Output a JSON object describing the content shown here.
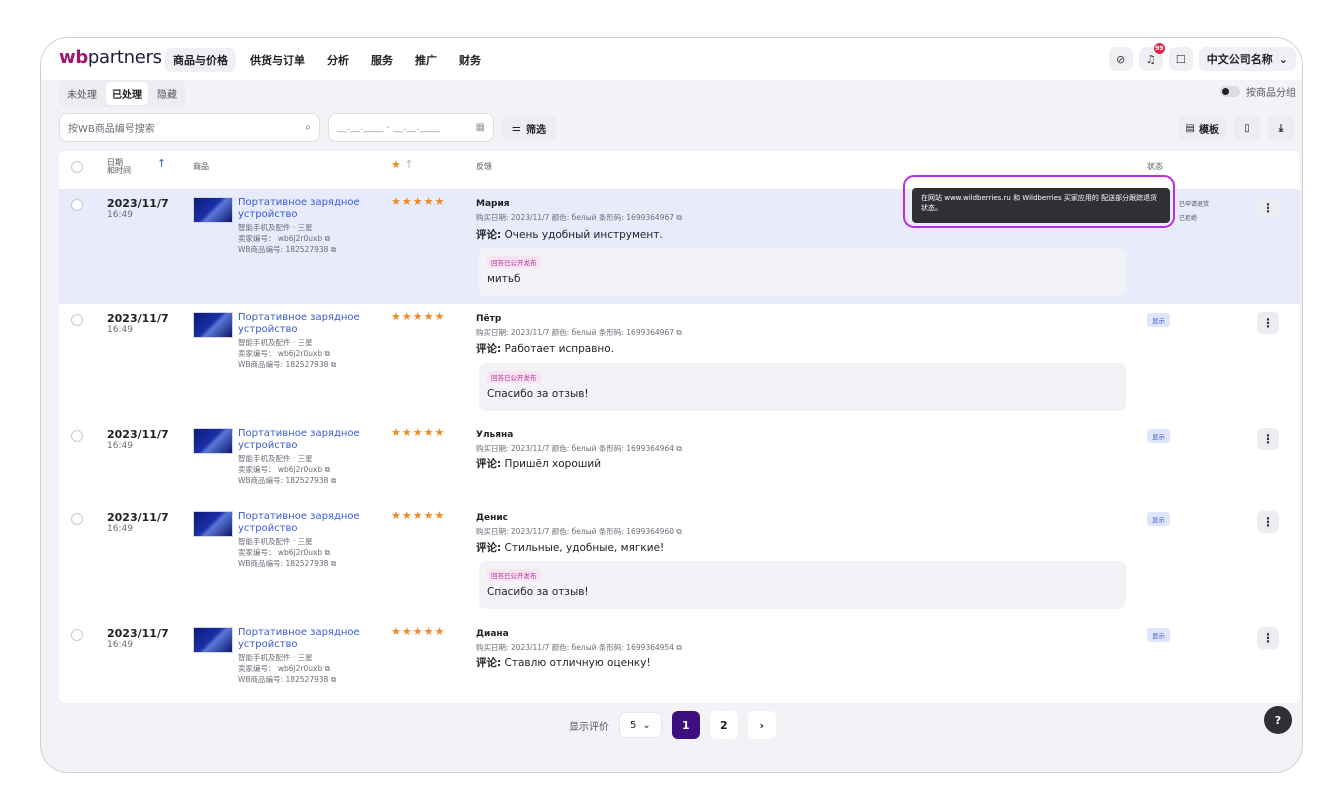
{
  "brand": {
    "logo_wb": "wb",
    "logo_rest": "partners"
  },
  "nav": [
    "商品与价格",
    "供货与订单",
    "分析",
    "服务",
    "推广",
    "财务"
  ],
  "top": {
    "notif_count": "99",
    "company": "中文公司名称"
  },
  "subtabs": [
    "未处理",
    "已处理",
    "隐藏"
  ],
  "group_toggle_label": "按商品分组",
  "search_placeholder": "按WB商品编号搜索",
  "date_placeholder": "__.__.____ - __.__.____",
  "filter_label": "筛选",
  "template_label": "模板",
  "headers": {
    "date": "日期",
    "datetime": "和时间",
    "product": "商品",
    "feedback": "反馈",
    "status": "状态"
  },
  "rows": [
    {
      "date": "2023/11/7",
      "time": "16:49",
      "product": "Портативное зарядное устройство",
      "category": "智能手机及配件 · 三星",
      "seller_sku": "卖家编号： wb6j2r0uxb",
      "wb_id": "WB商品编号: 182527938",
      "stars": "★★★★★",
      "user": "Мария",
      "meta": "购买日期: 2023/11/7   颜色: белый   条形码: 1699364967",
      "comment_prefix": "评论:",
      "comment": "Очень удобный инструмент.",
      "reply_tag": "回答已公开发布",
      "reply": "митьб",
      "status": ""
    },
    {
      "date": "2023/11/7",
      "time": "16:49",
      "product": "Портативное зарядное устройство",
      "category": "智能手机及配件 · 三星",
      "seller_sku": "卖家编号： wb6j2r0uxb",
      "wb_id": "WB商品编号: 182527938",
      "stars": "★★★★★",
      "user": "Пётр",
      "meta": "购买日期: 2023/11/7   颜色: белый   条形码: 1699364967",
      "comment_prefix": "评论:",
      "comment": "Работает исправно.",
      "reply_tag": "回答已公开发布",
      "reply": "Спасибо за отзыв!",
      "status": "显示"
    },
    {
      "date": "2023/11/7",
      "time": "16:49",
      "product": "Портативное зарядное устройство",
      "category": "智能手机及配件 · 三星",
      "seller_sku": "卖家编号： wb6j2r0uxb",
      "wb_id": "WB商品编号: 182527938",
      "stars": "★★★★★",
      "user": "Ульяна",
      "meta": "购买日期: 2023/11/7   颜色: белый   条形码: 1699364964",
      "comment_prefix": "评论:",
      "comment": "Пришёл хороший",
      "reply_tag": "",
      "reply": "",
      "status": "显示"
    },
    {
      "date": "2023/11/7",
      "time": "16:49",
      "product": "Портативное зарядное устройство",
      "category": "智能手机及配件 · 三星",
      "seller_sku": "卖家编号： wb6j2r0uxb",
      "wb_id": "WB商品编号: 182527938",
      "stars": "★★★★★",
      "user": "Денис",
      "meta": "购买日期: 2023/11/7   颜色: белый   条形码: 1699364960",
      "comment_prefix": "评论:",
      "comment": "Стильные, удобные, мягкие!",
      "reply_tag": "回答已公开发布",
      "reply": "Спасибо за отзыв!",
      "status": "显示"
    },
    {
      "date": "2023/11/7",
      "time": "16:49",
      "product": "Портативное зарядное устройство",
      "category": "智能手机及配件 · 三星",
      "seller_sku": "卖家编号： wb6j2r0uxb",
      "wb_id": "WB商品编号: 182527938",
      "stars": "★★★★★",
      "user": "Диана",
      "meta": "购买日期: 2023/11/7   颜色: белый   条形码: 1699364954",
      "comment_prefix": "评论:",
      "comment": "Ставлю отличную оценку!",
      "reply_tag": "",
      "reply": "",
      "status": "显示"
    }
  ],
  "tooltip": "在网站 www.wildberries.ru 和 Wildberries 买家应用的 配送部分跟踪退货状态。",
  "pending_status": [
    "已申请退货",
    "已拒绝"
  ],
  "pager": {
    "label": "显示评价",
    "page_size": "5",
    "pages": [
      "1",
      "2"
    ],
    "next": "›"
  },
  "help": "?",
  "colors": {
    "accent": "#3d0f7e",
    "link": "#3b5bd6",
    "star": "#f08a24",
    "tooltip_ring": "#bb2ee0",
    "highlight_row": "#e7ebfb"
  }
}
